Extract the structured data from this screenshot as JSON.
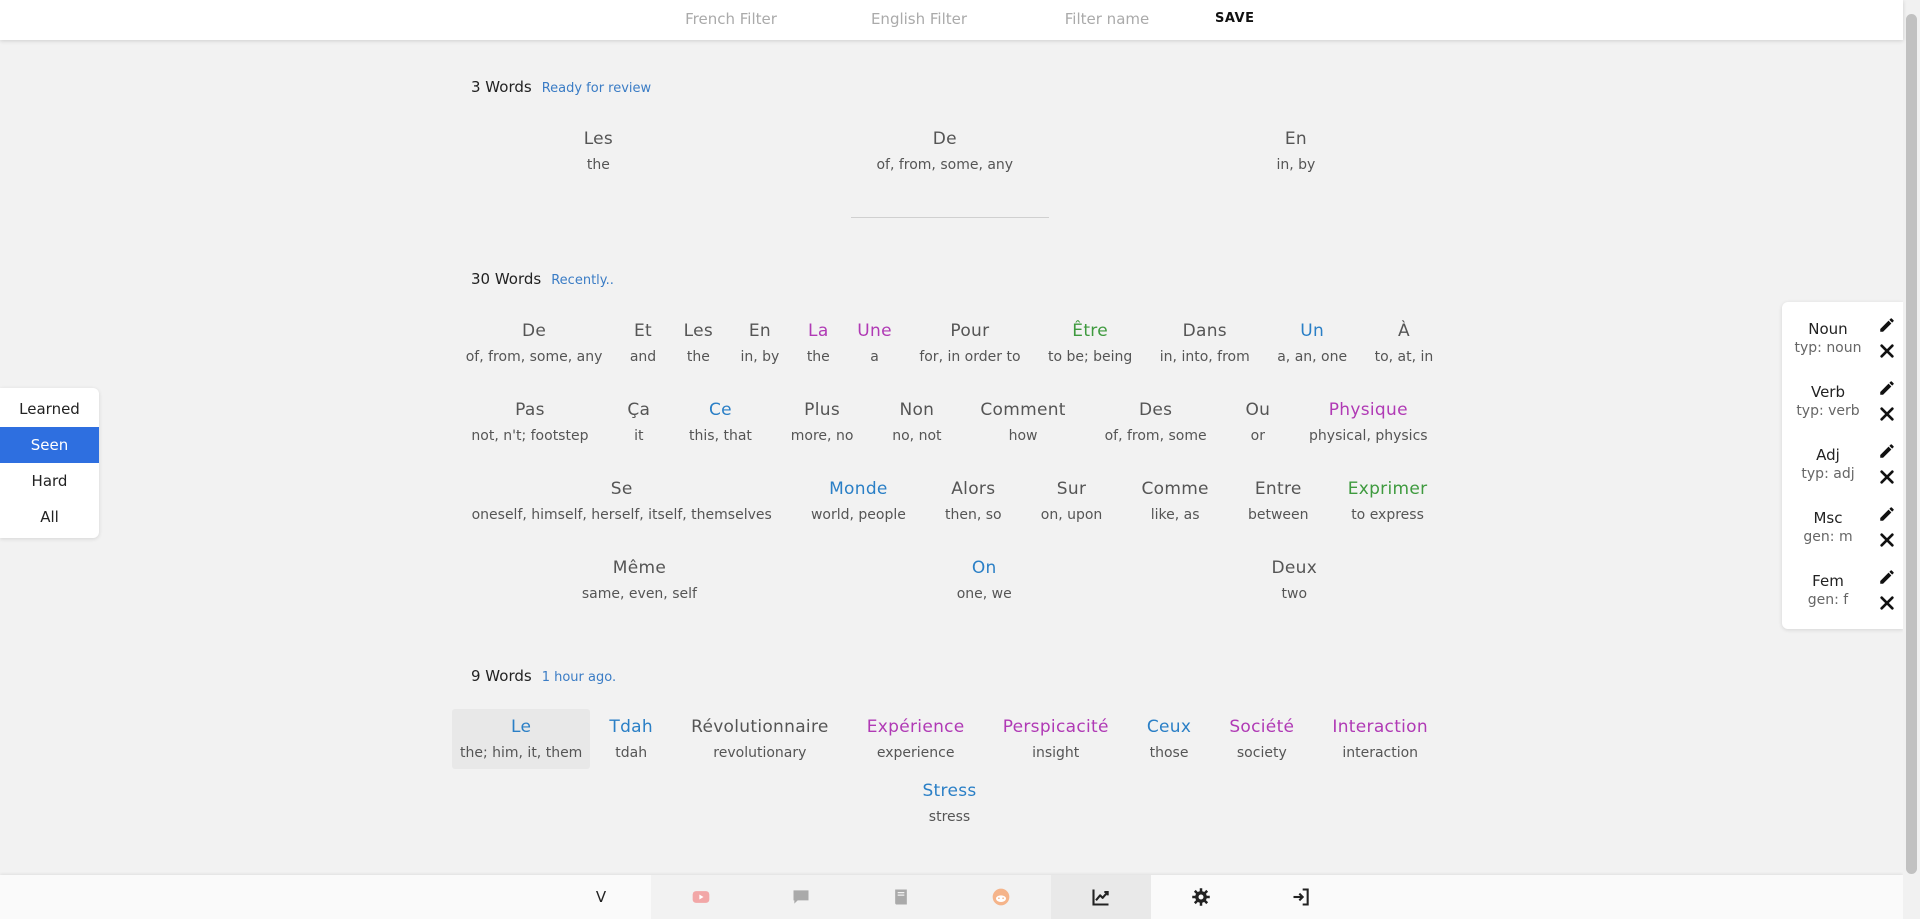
{
  "filters": {
    "french_placeholder": "French Filter",
    "english_placeholder": "English Filter",
    "name_placeholder": "Filter name",
    "save_label": "SAVE"
  },
  "sections": [
    {
      "count_label": "3 Words",
      "subtitle": "Ready for review",
      "rows": [
        [
          {
            "fr": "Les",
            "en": "the",
            "color": "default"
          },
          {
            "fr": "De",
            "en": "of, from, some, any",
            "color": "default"
          },
          {
            "fr": "En",
            "en": "in, by",
            "color": "default"
          }
        ]
      ]
    },
    {
      "count_label": "30 Words",
      "subtitle": "Recently..",
      "rows": [
        [
          {
            "fr": "De",
            "en": "of, from, some, any",
            "color": "default"
          },
          {
            "fr": "Et",
            "en": "and",
            "color": "default"
          },
          {
            "fr": "Les",
            "en": "the",
            "color": "default"
          },
          {
            "fr": "En",
            "en": "in, by",
            "color": "default"
          },
          {
            "fr": "La",
            "en": "the",
            "color": "purple"
          },
          {
            "fr": "Une",
            "en": "a",
            "color": "purple"
          },
          {
            "fr": "Pour",
            "en": "for, in order to",
            "color": "default"
          },
          {
            "fr": "Être",
            "en": "to be; being",
            "color": "green"
          },
          {
            "fr": "Dans",
            "en": "in, into, from",
            "color": "default"
          },
          {
            "fr": "Un",
            "en": "a, an, one",
            "color": "blue"
          },
          {
            "fr": "À",
            "en": "to, at, in",
            "color": "default"
          }
        ],
        [
          {
            "fr": "Pas",
            "en": "not, n't; footstep",
            "color": "default"
          },
          {
            "fr": "Ça",
            "en": "it",
            "color": "default"
          },
          {
            "fr": "Ce",
            "en": "this, that",
            "color": "blue"
          },
          {
            "fr": "Plus",
            "en": "more, no",
            "color": "default"
          },
          {
            "fr": "Non",
            "en": "no, not",
            "color": "default"
          },
          {
            "fr": "Comment",
            "en": "how",
            "color": "default"
          },
          {
            "fr": "Des",
            "en": "of, from, some",
            "color": "default"
          },
          {
            "fr": "Ou",
            "en": "or",
            "color": "default"
          },
          {
            "fr": "Physique",
            "en": "physical, physics",
            "color": "purple"
          }
        ],
        [
          {
            "fr": "Se",
            "en": "oneself, himself, herself, itself, themselves",
            "color": "default"
          },
          {
            "fr": "Monde",
            "en": "world, people",
            "color": "blue"
          },
          {
            "fr": "Alors",
            "en": "then, so",
            "color": "default"
          },
          {
            "fr": "Sur",
            "en": "on, upon",
            "color": "default"
          },
          {
            "fr": "Comme",
            "en": "like, as",
            "color": "default"
          },
          {
            "fr": "Entre",
            "en": "between",
            "color": "default"
          },
          {
            "fr": "Exprimer",
            "en": "to express",
            "color": "green"
          }
        ],
        [
          {
            "fr": "Même",
            "en": "same, even, self",
            "color": "default"
          },
          {
            "fr": "On",
            "en": "one, we",
            "color": "blue"
          },
          {
            "fr": "Deux",
            "en": "two",
            "color": "default"
          }
        ]
      ]
    },
    {
      "count_label": "9 Words",
      "subtitle": "1 hour ago.",
      "rows": [
        [
          {
            "fr": "Le",
            "en": "the; him, it, them",
            "color": "blue",
            "highlight": true
          },
          {
            "fr": "Tdah",
            "en": "tdah",
            "color": "blue"
          },
          {
            "fr": "Révolutionnaire",
            "en": "revolutionary",
            "color": "default"
          },
          {
            "fr": "Expérience",
            "en": "experience",
            "color": "purple"
          },
          {
            "fr": "Perspicacité",
            "en": "insight",
            "color": "purple"
          },
          {
            "fr": "Ceux",
            "en": "those",
            "color": "blue"
          },
          {
            "fr": "Société",
            "en": "society",
            "color": "purple"
          },
          {
            "fr": "Interaction",
            "en": "interaction",
            "color": "purple"
          }
        ],
        [
          {
            "fr": "Stress",
            "en": "stress",
            "color": "blue"
          }
        ]
      ]
    }
  ],
  "left_filter": {
    "options": [
      "Learned",
      "Seen",
      "Hard",
      "All"
    ],
    "selected": "Seen"
  },
  "tags": [
    {
      "name": "Noun",
      "sub": "typ: noun"
    },
    {
      "name": "Verb",
      "sub": "typ: verb"
    },
    {
      "name": "Adj",
      "sub": "typ: adj"
    },
    {
      "name": "Msc",
      "sub": "gen: m"
    },
    {
      "name": "Fem",
      "sub": "gen: f"
    }
  ],
  "bottom_nav": {
    "letter": "V",
    "items": [
      {
        "icon": "letter-v"
      },
      {
        "icon": "youtube-icon"
      },
      {
        "icon": "chat-icon"
      },
      {
        "icon": "book-icon"
      },
      {
        "icon": "reddit-icon"
      },
      {
        "icon": "chart-line-icon",
        "active": true
      },
      {
        "icon": "gear-icon"
      },
      {
        "icon": "sign-in-icon"
      }
    ]
  },
  "colors": {
    "blue": "#2a7fc6",
    "purple": "#b03ab5",
    "green": "#3e9a3e",
    "accent": "#2e6fe0"
  }
}
